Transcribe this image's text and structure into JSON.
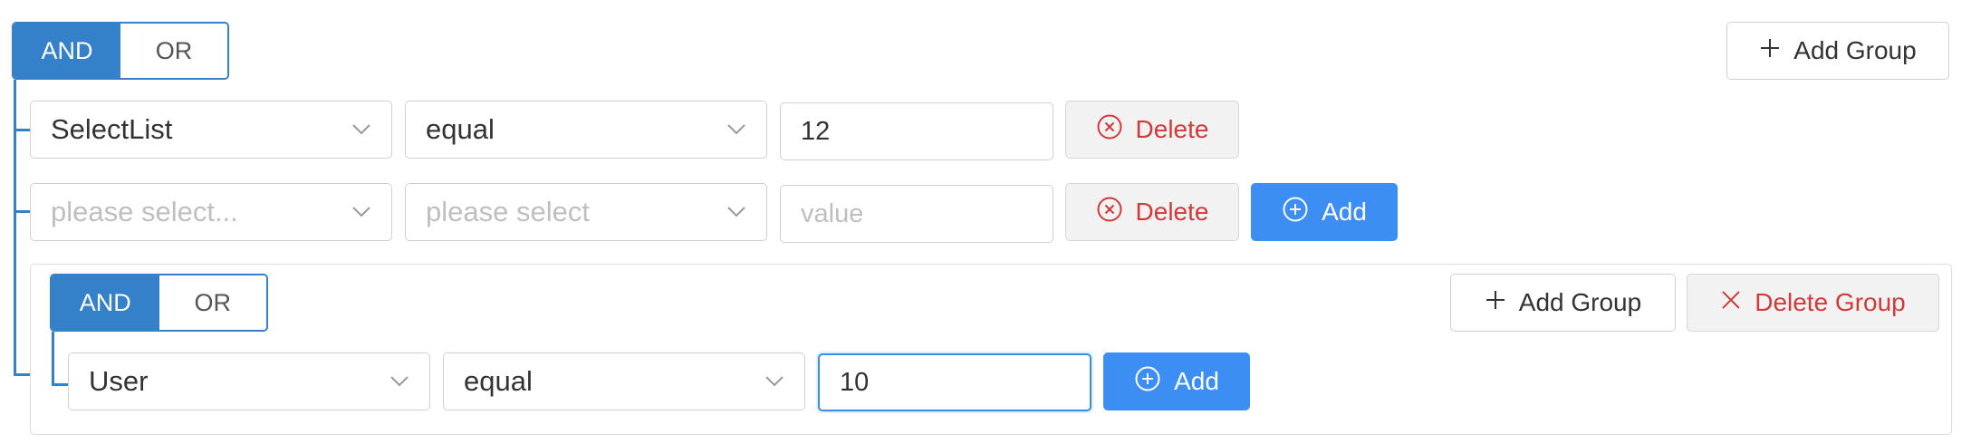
{
  "root_group": {
    "and_label": "AND",
    "or_label": "OR",
    "add_group_label": "Add Group",
    "rules": [
      {
        "field": "SelectList",
        "field_placeholder": false,
        "operator": "equal",
        "operator_placeholder": false,
        "value": "12",
        "value_placeholder": false,
        "delete_label": "Delete",
        "show_add": false
      },
      {
        "field": "please select...",
        "field_placeholder": true,
        "operator": "please select",
        "operator_placeholder": true,
        "value": "value",
        "value_placeholder": true,
        "delete_label": "Delete",
        "add_label": "Add",
        "show_add": true
      }
    ]
  },
  "sub_group": {
    "and_label": "AND",
    "or_label": "OR",
    "add_group_label": "Add Group",
    "delete_group_label": "Delete Group",
    "rule": {
      "field": "User",
      "operator": "equal",
      "value": "10",
      "add_label": "Add"
    }
  },
  "colors": {
    "accent": "#3481c9",
    "primary_button": "#3d8ef2",
    "danger": "#d23a3a"
  }
}
